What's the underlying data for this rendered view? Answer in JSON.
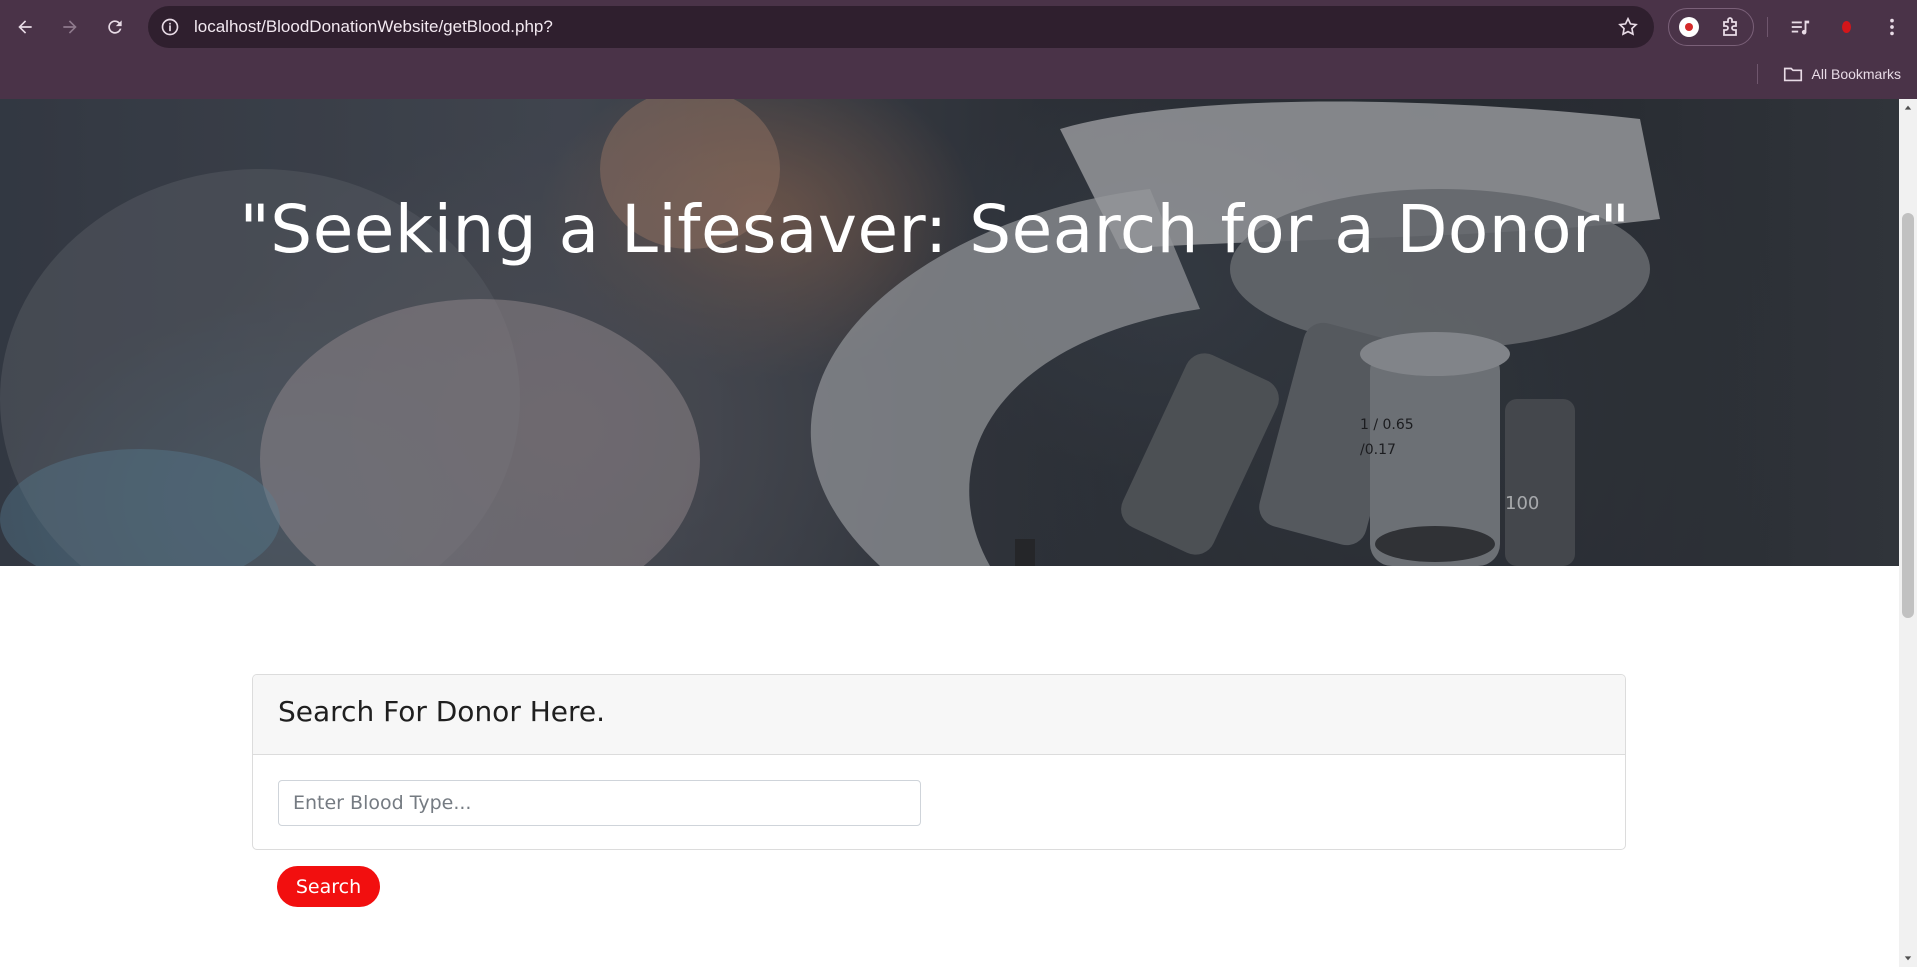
{
  "browser": {
    "url": "localhost/BloodDonationWebsite/getBlood.php?",
    "bookmarks_label": "All Bookmarks",
    "accent_color": "#4a3348"
  },
  "hero": {
    "title": "\"Seeking a Lifesaver: Search for a Donor\"",
    "lens_text_1": "1 / 0.65",
    "lens_text_2": "/0.17",
    "lens_text_3": "100"
  },
  "search": {
    "heading": "Search For Donor Here.",
    "input_placeholder": "Enter Blood Type...",
    "input_value": "",
    "button_label": "Search",
    "button_color": "#f20f0f"
  }
}
